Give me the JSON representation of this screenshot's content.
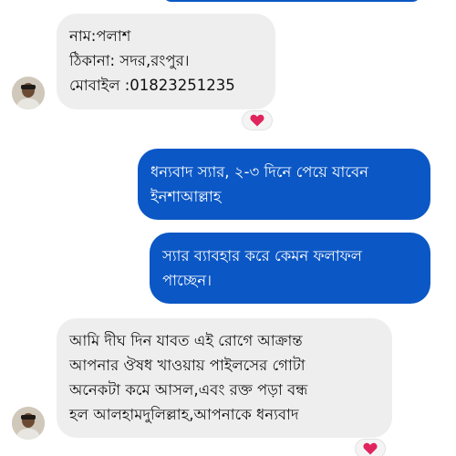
{
  "messages": [
    {
      "direction": "incoming",
      "lines": [
        "নাম:পলাশ",
        "ঠিকানা: সদর,রংপুর।",
        "মোবাইল :01823251235"
      ],
      "reaction": "heart-icon"
    },
    {
      "direction": "outgoing",
      "lines": [
        "ধন্যবাদ স্যার, ২-৩ দিনে পেয়ে যাবেন",
        "ইনশাআল্লাহ"
      ]
    },
    {
      "direction": "outgoing",
      "lines": [
        "স্যার ব্যাবহার করে কেমন ফলাফল",
        "পাচ্ছেন।"
      ]
    },
    {
      "direction": "incoming",
      "lines": [
        "আমি দীঘ দিন যাবত এই রোগে আক্রান্ত",
        "আপনার ঔষধ খাওয়ায় পাইলসের গোটা",
        "অনেকটা কমে আসল,এবং রক্ত পড়া বন্ধ",
        "হল আলহামদুলিল্লাহ,আপনাকে ধন্যবাদ"
      ],
      "reaction": "heart-icon"
    }
  ],
  "colors": {
    "outgoing_bubble": "#0b57c5",
    "incoming_bubble": "#eeeeee",
    "heart": "#e0245e"
  }
}
